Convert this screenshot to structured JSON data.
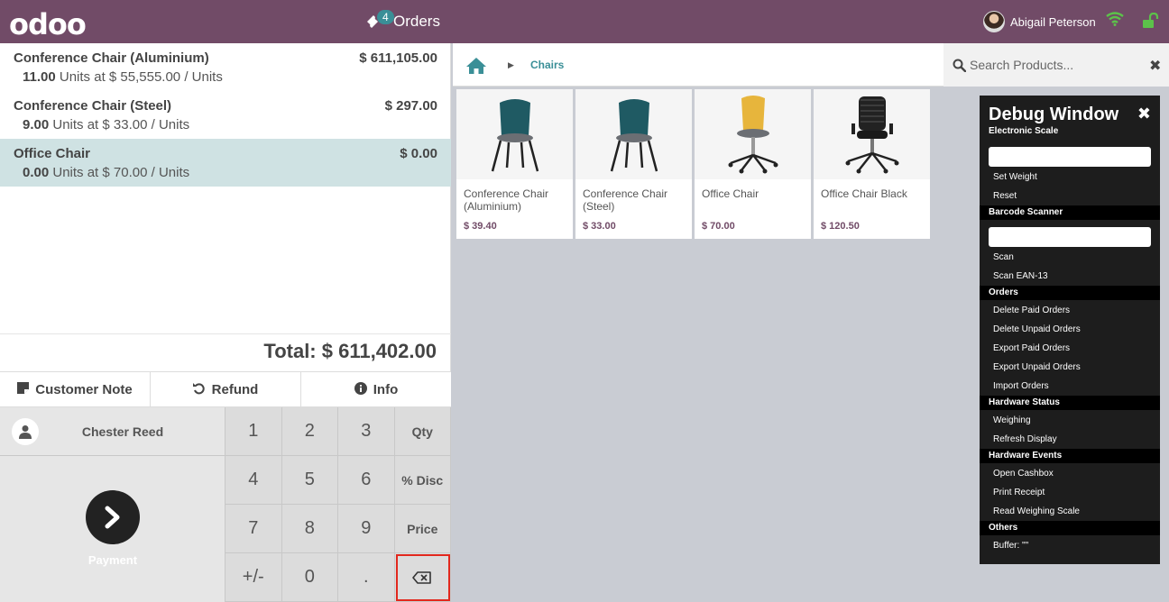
{
  "header": {
    "logo": "odoo",
    "orders_label": "Orders",
    "orders_count": "4",
    "user_name": "Abigail Peterson"
  },
  "orderlines": [
    {
      "name": "Conference Chair (Aluminium)",
      "price": "$ 611,105.00",
      "qty": "11.00",
      "unit_info": " Units at $ 55,555.00 / Units",
      "selected": false
    },
    {
      "name": "Conference Chair (Steel)",
      "price": "$ 297.00",
      "qty": "9.00",
      "unit_info": " Units at $ 33.00 / Units",
      "selected": false
    },
    {
      "name": "Office Chair",
      "price": "$ 0.00",
      "qty": "0.00",
      "unit_info": " Units at $ 70.00 / Units",
      "selected": true
    }
  ],
  "total": "Total: $ 611,402.00",
  "controls": {
    "customer_note": "Customer Note",
    "refund": "Refund",
    "info": "Info"
  },
  "customer_name": "Chester Reed",
  "payment_label": "Payment",
  "numpad": {
    "keys": [
      "1",
      "2",
      "3",
      "Qty",
      "4",
      "5",
      "6",
      "% Disc",
      "7",
      "8",
      "9",
      "Price",
      "+/-",
      "0",
      "."
    ]
  },
  "breadcrumb": {
    "category": "Chairs"
  },
  "search": {
    "placeholder": "Search Products..."
  },
  "products": [
    {
      "name": "Conference Chair (Aluminium)",
      "price": "$ 39.40",
      "image": "chair-dark-icon"
    },
    {
      "name": "Conference Chair (Steel)",
      "price": "$ 33.00",
      "image": "chair-dark-icon"
    },
    {
      "name": "Office Chair",
      "price": "$ 70.00",
      "image": "office-chair-yellow-icon"
    },
    {
      "name": "Office Chair Black",
      "price": "$ 120.50",
      "image": "office-chair-black-icon"
    }
  ],
  "debug": {
    "title": "Debug Window",
    "sections": {
      "electronic_scale": "Electronic Scale",
      "barcode_scanner": "Barcode Scanner",
      "orders": "Orders",
      "hardware_status": "Hardware Status",
      "hardware_events": "Hardware Events",
      "others": "Others"
    },
    "items": {
      "set_weight": "Set Weight",
      "reset": "Reset",
      "scan": "Scan",
      "scan_ean13": "Scan EAN-13",
      "delete_paid": "Delete Paid Orders",
      "delete_unpaid": "Delete Unpaid Orders",
      "export_paid": "Export Paid Orders",
      "export_unpaid": "Export Unpaid Orders",
      "import_orders": "Import Orders",
      "weighing": "Weighing",
      "refresh_display": "Refresh Display",
      "open_cashbox": "Open Cashbox",
      "print_receipt": "Print Receipt",
      "read_scale": "Read Weighing Scale",
      "buffer": "Buffer: \"\""
    }
  },
  "colors": {
    "brand": "#714b67",
    "accent": "#3a8f97",
    "selected_line": "#cfe2e3"
  }
}
